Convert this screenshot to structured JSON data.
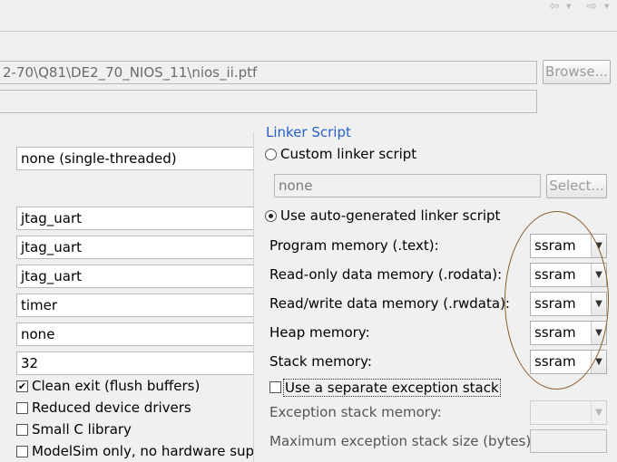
{
  "toolbar": {
    "back_icon": "back-arrow-icon",
    "forward_icon": "forward-arrow-icon"
  },
  "sopc": {
    "path_value": "2-70\\Q81\\DE2_70_NIOS_11\\nios_ii.ptf",
    "browse_label": "Browse...",
    "second_field_value": ""
  },
  "left": {
    "rtos_value": "none (single-threaded)",
    "stdout_value": "jtag_uart",
    "stderr_value": "jtag_uart",
    "stdin_value": "jtag_uart",
    "sys_clock_value": "timer",
    "timestamp_value": "none",
    "max_file_desc_value": "32",
    "checkboxes": [
      {
        "label": "Clean exit (flush buffers)",
        "checked": true
      },
      {
        "label": "Reduced device drivers",
        "checked": false
      },
      {
        "label": "Small C library",
        "checked": false
      },
      {
        "label": "ModelSim only, no hardware supp",
        "checked": false
      }
    ]
  },
  "linker": {
    "title": "Linker Script",
    "custom_label": "Custom linker script",
    "custom_selected": false,
    "custom_path_value": "none",
    "select_label": "Select...",
    "auto_label": "Use auto-generated linker script",
    "auto_selected": true,
    "rows": [
      {
        "label": "Program memory (.text):",
        "value": "ssram"
      },
      {
        "label": "Read-only data memory (.rodata):",
        "value": "ssram"
      },
      {
        "label": "Read/write data memory (.rwdata):",
        "value": "ssram"
      },
      {
        "label": "Heap memory:",
        "value": "ssram"
      },
      {
        "label": "Stack memory:",
        "value": "ssram"
      }
    ],
    "separate_stack_label": "Use a separate exception stack",
    "separate_stack_checked": false,
    "exception_memory_label": "Exception stack memory:",
    "exception_memory_value": "",
    "exception_size_label": "Maximum exception stack size (bytes):",
    "exception_size_value": ""
  },
  "colors": {
    "group_title": "#2760c4",
    "annotation_oval": "#8a5a2b"
  }
}
